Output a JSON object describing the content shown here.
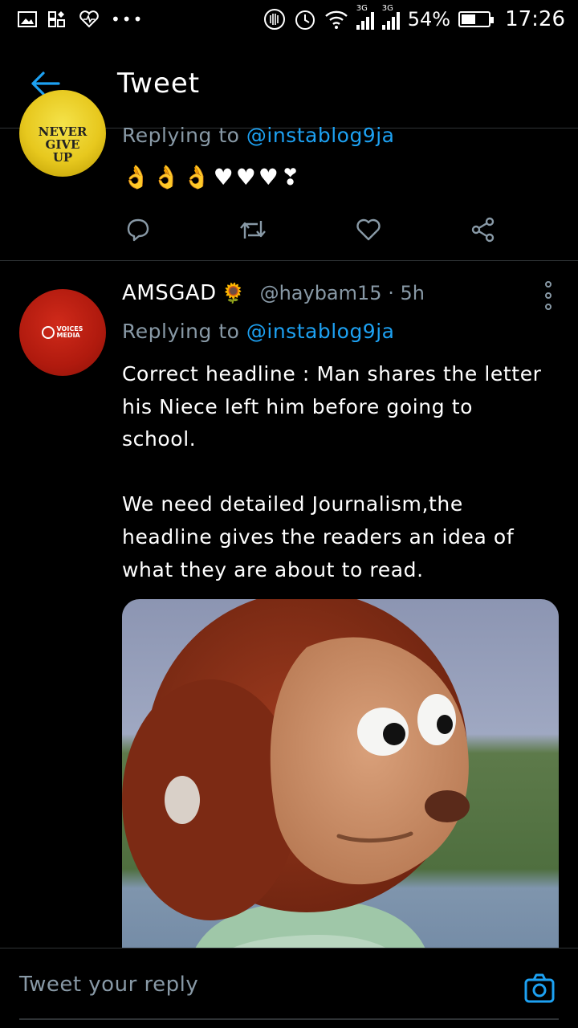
{
  "status_bar": {
    "left_icons": [
      "gallery-icon",
      "apps-icon",
      "health-icon",
      "more-dots-icon"
    ],
    "network_label_1": "3G",
    "network_label_2": "3G",
    "battery_percent": "54%",
    "battery_level": 0.54,
    "time": "17:26"
  },
  "header": {
    "title": "Tweet",
    "back_icon": "arrow-left-icon",
    "accent_color": "#1da1f2"
  },
  "tweet_1": {
    "avatar_text": "NEVER\nGIVE\nUP",
    "replying_prefix": "Replying to ",
    "replying_handle": "@instablog9ja",
    "emojis": "👌👌👌♥♥♥❣"
  },
  "tweet_2": {
    "display_name": "AMSGAD",
    "name_emoji": "🌻",
    "handle": "@haybam15",
    "separator": "·",
    "time": "5h",
    "replying_prefix": "Replying to ",
    "replying_handle": "@instablog9ja",
    "avatar_text": "VOICES MEDIA",
    "text": "Correct headline : Man shares the letter his Niece left him before going to school.\n\nWe need detailed Journalism,the headline gives the readers an idea of what they are about to read."
  },
  "reply_bar": {
    "placeholder": "Tweet your reply",
    "camera_icon": "camera-icon"
  }
}
